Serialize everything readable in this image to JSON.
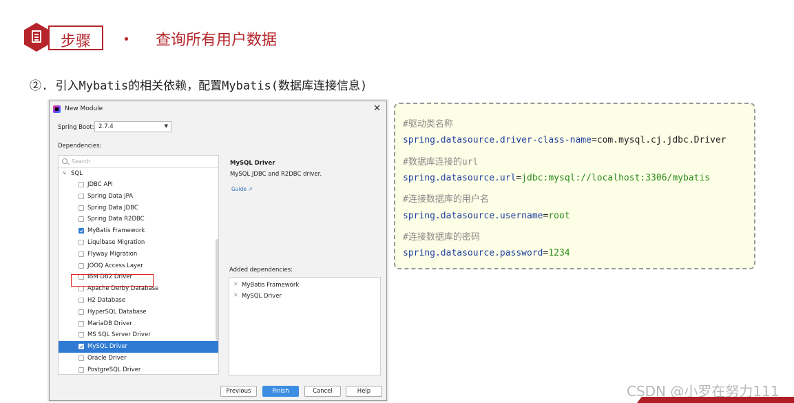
{
  "header": {
    "step_label": "步骤",
    "title": "查询所有用户数据"
  },
  "subheading": "②. 引入Mybatis的相关依赖，配置Mybatis(数据库连接信息)",
  "dialog": {
    "title": "New Module",
    "spring_boot_label": "Spring Boot:",
    "spring_boot_version": "2.7.4",
    "dependencies_label": "Dependencies:",
    "search_placeholder": "Search",
    "group": "SQL",
    "items": [
      {
        "label": "JDBC API",
        "checked": false
      },
      {
        "label": "Spring Data JPA",
        "checked": false
      },
      {
        "label": "Spring Data JDBC",
        "checked": false
      },
      {
        "label": "Spring Data R2DBC",
        "checked": false
      },
      {
        "label": "MyBatis Framework",
        "checked": true
      },
      {
        "label": "Liquibase Migration",
        "checked": false
      },
      {
        "label": "Flyway Migration",
        "checked": false
      },
      {
        "label": "JOOQ Access Layer",
        "checked": false
      },
      {
        "label": "IBM DB2 Driver",
        "checked": false
      },
      {
        "label": "Apache Derby Database",
        "checked": false
      },
      {
        "label": "H2 Database",
        "checked": false
      },
      {
        "label": "HyperSQL Database",
        "checked": false
      },
      {
        "label": "MariaDB Driver",
        "checked": false
      },
      {
        "label": "MS SQL Server Driver",
        "checked": false
      },
      {
        "label": "MySQL Driver",
        "checked": true
      },
      {
        "label": "Oracle Driver",
        "checked": false
      },
      {
        "label": "PostgreSQL Driver",
        "checked": false
      }
    ],
    "detail": {
      "title": "MySQL Driver",
      "description": "MySQL JDBC and R2DBC driver.",
      "guide": "Guide ↗"
    },
    "added_label": "Added dependencies:",
    "added": [
      "MyBatis Framework",
      "MySQL Driver"
    ],
    "buttons": {
      "previous": "Previous",
      "finish": "Finish",
      "cancel": "Cancel",
      "help": "Help"
    }
  },
  "code": {
    "lines": [
      {
        "type": "comment",
        "text": "#驱动类名称"
      },
      {
        "type": "prop",
        "key": "spring.datasource.driver-class-name",
        "value": "com.mysql.cj.jdbc.Driver",
        "value_color": "#222222"
      },
      {
        "type": "comment",
        "text": "#数据库连接的url"
      },
      {
        "type": "prop",
        "key": "spring.datasource.url",
        "value": "jdbc:mysql://localhost:3306/mybatis",
        "value_color": "#2a8a1a"
      },
      {
        "type": "comment",
        "text": "#连接数据库的用户名"
      },
      {
        "type": "prop",
        "key": "spring.datasource.username",
        "value": "root",
        "value_color": "#2a8a1a"
      },
      {
        "type": "comment",
        "text": "#连接数据库的密码"
      },
      {
        "type": "prop",
        "key": "spring.datasource.password",
        "value": "1234",
        "value_color": "#2a8a1a"
      }
    ]
  },
  "watermark": "CSDN @小罗在努力111",
  "colors": {
    "brand_red": "#b5252b",
    "selection_blue": "#2f7bd4",
    "code_bg": "#fdfee6"
  }
}
